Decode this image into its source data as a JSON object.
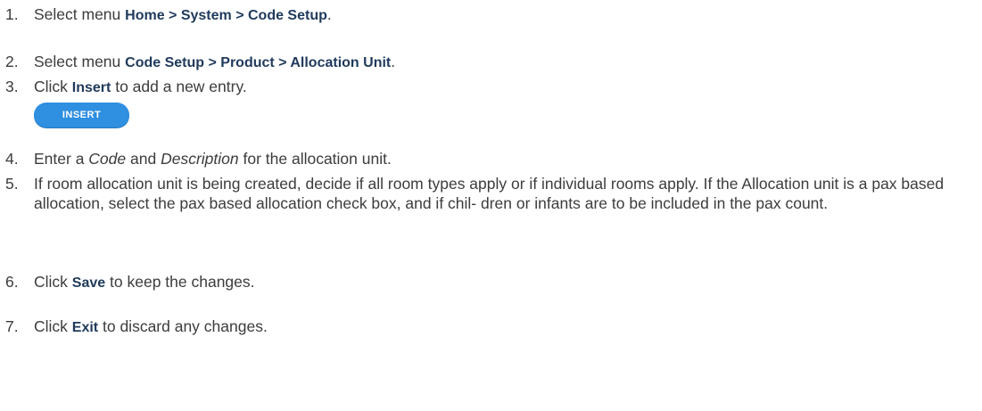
{
  "steps": [
    {
      "num": "1.",
      "pre": "Select menu ",
      "kw": "Home > System > Code Setup",
      "post": "."
    },
    {
      "num": "2.",
      "pre": "Select menu ",
      "kw": "Code Setup > Product > Allocation Unit",
      "post": "."
    },
    {
      "num": "3.",
      "pre": "Click ",
      "kw": "Insert",
      "post": " to add a new entry."
    },
    {
      "num": "4.",
      "pre": "Enter a ",
      "em1": "Code",
      "mid": " and ",
      "em2": "Description",
      "post": " for the allocation unit."
    },
    {
      "num": "5.",
      "text": "If room allocation unit is being created, decide if all room types apply or if individual rooms apply. If the Allocation unit is a pax based allocation, select the pax based allocation check box, and if chil- dren or infants are to be included in the pax count."
    },
    {
      "num": "6.",
      "pre": "Click ",
      "kw": "Save",
      "post": " to keep the changes."
    },
    {
      "num": "7.",
      "pre": "Click ",
      "kw": "Exit",
      "post": " to discard any changes."
    }
  ],
  "insert_button": {
    "label": "INSERT",
    "color": "#2f8fe0"
  }
}
